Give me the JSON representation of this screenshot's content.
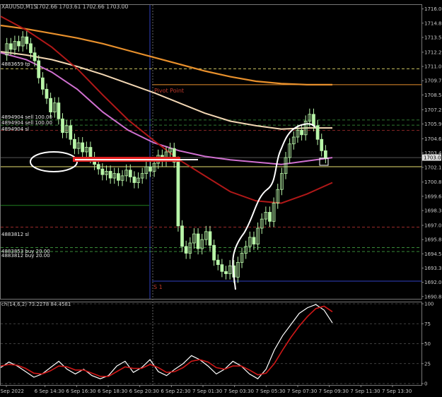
{
  "window": {
    "symbol_header": "XAUUSD,M15",
    "ohlc": "1702.66 1703.61 1702.66 1703.00",
    "indicator_header": "ch(14,6,2) 73.2278 84.4581"
  },
  "markers": {
    "pivot_label": "Pivot Point",
    "s1_label": "S 1"
  },
  "orders": [
    {
      "label": "4883659 tp",
      "price": 1710.8
    },
    {
      "label": "4894904 sell 100.00",
      "price": 1706.3
    },
    {
      "label": "4894904 sell 100.00",
      "price": 1705.85
    },
    {
      "label": "4894904 sl",
      "price": 1705.4
    },
    {
      "label": "4883812 sl",
      "price": 1696.9
    },
    {
      "label": "4883853 buy 20.00",
      "price": 1695.1
    },
    {
      "label": "4883812 buy 20.00",
      "price": 1694.75
    }
  ],
  "colors": {
    "background": "#000000",
    "candle": "#b8f5a8",
    "pink_ma": "#d070d0",
    "orange_ma": "#e8902c",
    "cream_ma": "#f3d7b4",
    "red_ma": "#b01818",
    "yellow_level": "#e8e070",
    "blue_level": "#3040c0",
    "green_level": "#208020",
    "white_annot": "#ffffff",
    "red_arrow": "#e02020",
    "grid": "#4a4a4a"
  },
  "chart_data": [
    {
      "type": "candlestick",
      "title": "XAUUSD,M15",
      "ylim": [
        1690.6,
        1716.4
      ],
      "yticks": [
        1716.05,
        1714.8,
        1713.55,
        1712.25,
        1711.0,
        1709.75,
        1708.5,
        1707.2,
        1705.95,
        1704.65,
        1703.4,
        1702.15,
        1700.85,
        1699.6,
        1698.35,
        1697.05,
        1695.8,
        1694.55,
        1693.3,
        1692.05,
        1690.8
      ],
      "current_price": 1703.0,
      "xticks": [
        "6 Sep 2022",
        "6 Sep 14:30",
        "6 Sep 16:30",
        "6 Sep 18:30",
        "6 Sep 20:30",
        "6 Sep 22:30",
        "7 Sep 01:30",
        "7 Sep 03:30",
        "7 Sep 05:30",
        "7 Sep 07:30",
        "7 Sep 09:30",
        "7 Sep 11:30",
        "7 Sep 13:30"
      ],
      "horizontal_levels": [
        {
          "name": "Pivot Point",
          "price": 1709.4
        },
        {
          "name": "S 1",
          "price": 1692.15
        },
        {
          "name": "yellow",
          "price": 1702.2
        },
        {
          "name": "green",
          "price": 1698.8
        }
      ],
      "series": [
        {
          "name": "orange_ma",
          "values": [
            1714.6,
            1714.3,
            1713.9,
            1713.5,
            1713.0,
            1712.4,
            1711.8,
            1711.2,
            1710.6,
            1710.1,
            1709.7,
            1709.5,
            1709.4,
            1709.4
          ]
        },
        {
          "name": "cream_ma",
          "values": [
            1712.3,
            1712.0,
            1711.6,
            1711.0,
            1710.3,
            1709.5,
            1708.7,
            1707.8,
            1706.9,
            1706.2,
            1705.8,
            1705.5,
            1705.6,
            1705.6
          ]
        },
        {
          "name": "pink_ma",
          "values": [
            1712.2,
            1711.6,
            1710.5,
            1709.0,
            1707.0,
            1705.4,
            1704.3,
            1703.6,
            1703.1,
            1702.8,
            1702.6,
            1702.4,
            1702.7,
            1703.0
          ]
        },
        {
          "name": "red_ma",
          "values": [
            1715.4,
            1714.2,
            1712.7,
            1710.8,
            1708.5,
            1706.3,
            1704.5,
            1702.8,
            1701.4,
            1700.0,
            1699.2,
            1699.0,
            1699.8,
            1700.8
          ]
        }
      ]
    },
    {
      "type": "line",
      "title": "ch(14,6,2) 73.2278 84.4581",
      "ylim": [
        0,
        100
      ],
      "yticks": [
        100,
        75,
        50,
        25,
        0
      ],
      "series": [
        {
          "name": "main",
          "values": [
            20,
            27,
            22,
            15,
            8,
            12,
            20,
            28,
            18,
            12,
            18,
            10,
            6,
            10,
            22,
            28,
            14,
            20,
            30,
            15,
            10,
            18,
            25,
            35,
            30,
            22,
            12,
            18,
            28,
            22,
            12,
            6,
            18,
            42,
            60,
            74,
            88,
            95,
            99,
            92,
            76
          ]
        },
        {
          "name": "signal",
          "values": [
            22,
            24,
            23,
            19,
            13,
            12,
            16,
            22,
            21,
            17,
            17,
            13,
            9,
            9,
            15,
            21,
            19,
            19,
            24,
            20,
            14,
            15,
            20,
            28,
            30,
            27,
            20,
            18,
            22,
            22,
            17,
            11,
            13,
            25,
            42,
            58,
            72,
            84,
            94,
            97,
            90
          ]
        }
      ]
    }
  ]
}
